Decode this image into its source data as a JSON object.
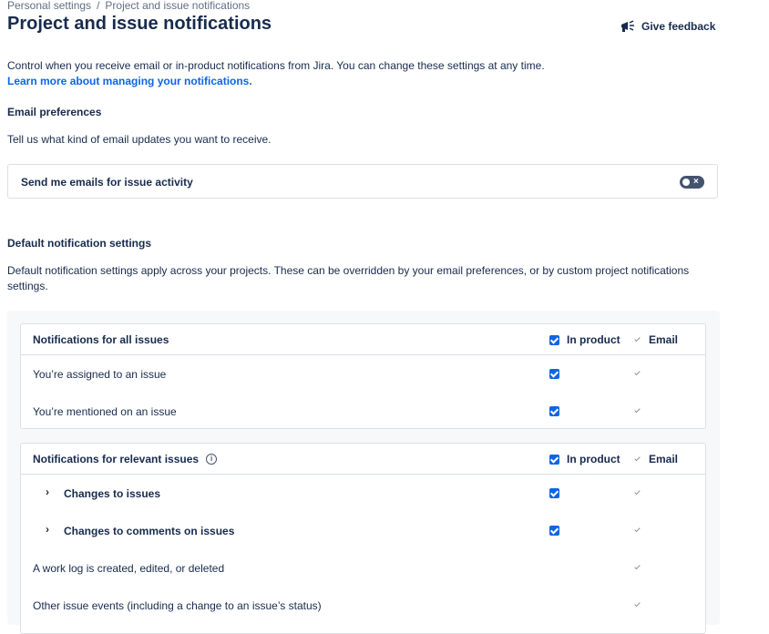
{
  "breadcrumb": {
    "parent": "Personal settings",
    "separator": "/",
    "current": "Project and issue notifications"
  },
  "page": {
    "title": "Project and issue notifications"
  },
  "header": {
    "feedback_label": "Give feedback",
    "feedback_icon": "megaphone-icon"
  },
  "intro": {
    "text": "Control when you receive email or in-product notifications from Jira. You can change these settings at any time.",
    "link": "Learn more about managing your notifications."
  },
  "email_preferences": {
    "heading": "Email preferences",
    "description": "Tell us what kind of email updates you want to receive.",
    "toggle_label": "Send me emails for issue activity",
    "toggle_on": false
  },
  "defaults": {
    "heading": "Default notification settings",
    "description": "Default notification settings apply across your projects. These can be overridden by your email preferences, or by custom project notifications settings."
  },
  "columns": {
    "in_product": "In product",
    "email": "Email"
  },
  "groups": [
    {
      "title": "Notifications for all issues",
      "rows": [
        {
          "label": "You’re assigned to an issue",
          "in_product": true,
          "email": true
        },
        {
          "label": "You’re mentioned on an issue",
          "in_product": true,
          "email": true
        }
      ]
    },
    {
      "title": "Notifications for relevant issues",
      "info_icon": "info-icon",
      "rows": [
        {
          "label": "Changes to issues",
          "expandable": true,
          "in_product": true,
          "email": true
        },
        {
          "label": "Changes to comments on issues",
          "expandable": true,
          "in_product": true,
          "email": true
        },
        {
          "label": "A work log is created, edited, or deleted",
          "in_product": false,
          "email": true
        },
        {
          "label": "Other issue events (including a change to an issue’s status)",
          "in_product": false,
          "email": true
        }
      ]
    }
  ],
  "colors": {
    "accent": "#0c66e4",
    "text": "#172b4d",
    "subtle": "#626f86",
    "border": "#dcdfe4",
    "panel": "#f7f8f9"
  }
}
